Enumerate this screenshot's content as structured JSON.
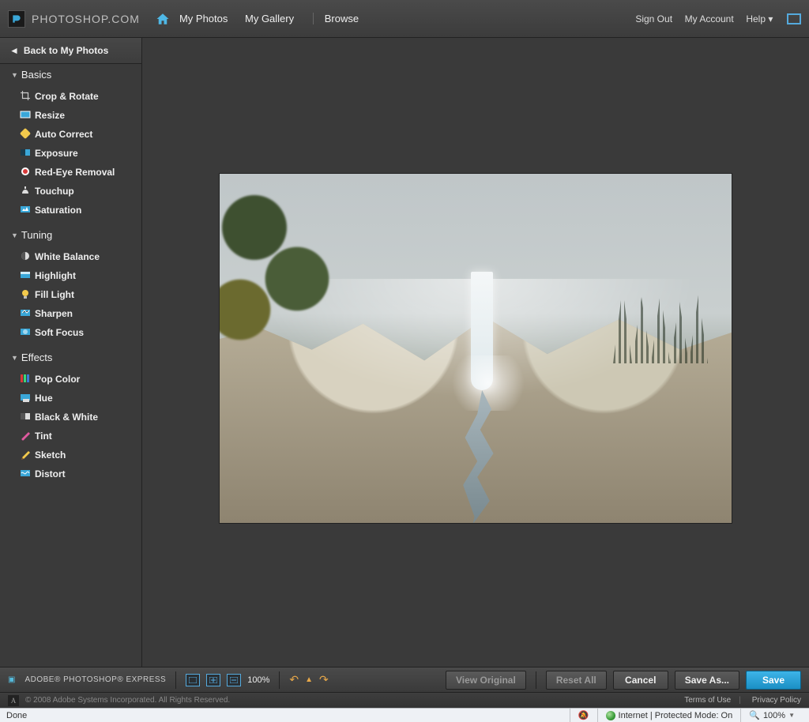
{
  "topbar": {
    "brand": "PHOTOSHOP.COM",
    "nav": {
      "myPhotos": "My Photos",
      "myGallery": "My Gallery",
      "browse": "Browse"
    },
    "right": {
      "signOut": "Sign Out",
      "myAccount": "My Account",
      "help": "Help"
    }
  },
  "sidebar": {
    "back": "Back to My Photos",
    "sections": [
      {
        "title": "Basics",
        "tools": [
          {
            "id": "crop-rotate",
            "label": "Crop & Rotate"
          },
          {
            "id": "resize",
            "label": "Resize"
          },
          {
            "id": "auto-correct",
            "label": "Auto Correct"
          },
          {
            "id": "exposure",
            "label": "Exposure"
          },
          {
            "id": "red-eye",
            "label": "Red-Eye Removal"
          },
          {
            "id": "touchup",
            "label": "Touchup"
          },
          {
            "id": "saturation",
            "label": "Saturation"
          }
        ]
      },
      {
        "title": "Tuning",
        "tools": [
          {
            "id": "white-balance",
            "label": "White Balance"
          },
          {
            "id": "highlight",
            "label": "Highlight"
          },
          {
            "id": "fill-light",
            "label": "Fill Light"
          },
          {
            "id": "sharpen",
            "label": "Sharpen"
          },
          {
            "id": "soft-focus",
            "label": "Soft Focus"
          }
        ]
      },
      {
        "title": "Effects",
        "tools": [
          {
            "id": "pop-color",
            "label": "Pop Color"
          },
          {
            "id": "hue",
            "label": "Hue"
          },
          {
            "id": "black-white",
            "label": "Black & White"
          },
          {
            "id": "tint",
            "label": "Tint"
          },
          {
            "id": "sketch",
            "label": "Sketch"
          },
          {
            "id": "distort",
            "label": "Distort"
          }
        ]
      }
    ]
  },
  "bottombar": {
    "appLabel": "ADOBE® PHOTOSHOP® EXPRESS",
    "zoom": "100%",
    "viewOriginal": "View Original",
    "resetAll": "Reset All",
    "cancel": "Cancel",
    "saveAs": "Save As...",
    "save": "Save"
  },
  "footer": {
    "copyright": "© 2008 Adobe Systems Incorporated. All Rights Reserved.",
    "terms": "Terms of Use",
    "privacy": "Privacy Policy"
  },
  "status": {
    "left": "Done",
    "zone": "Internet | Protected Mode: On",
    "zoom": "100%"
  }
}
